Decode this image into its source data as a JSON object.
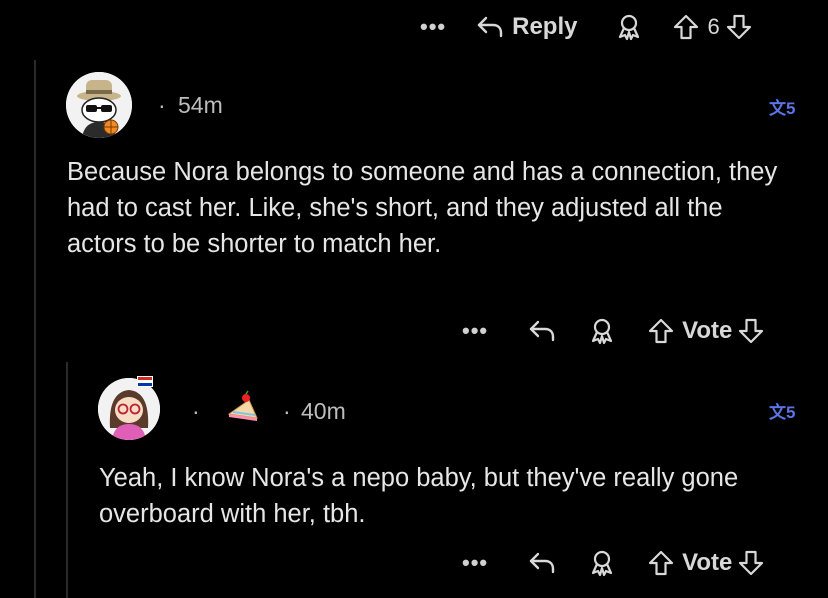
{
  "top_actions": {
    "reply_label": "Reply",
    "vote_count": "6"
  },
  "comment1": {
    "time": "54m",
    "separator": "·",
    "translate_label": "文5",
    "text": "Because Nora belongs to someone and has a connection, they had to cast her. Like, she's short, and they adjusted all the actors to be shorter to match her.",
    "vote_label": "Vote"
  },
  "comment2": {
    "time": "40m",
    "separator": "·",
    "translate_label": "文5",
    "text": "Yeah, I know Nora's a nepo baby, but they've really gone overboard with her, tbh.",
    "vote_label": "Vote"
  },
  "icons": {
    "more": "more-options-icon",
    "reply": "reply-arrow-icon",
    "award": "award-icon",
    "upvote": "upvote-icon",
    "downvote": "downvote-icon",
    "translate": "translate-icon"
  },
  "colors": {
    "background": "#000000",
    "accent": "#5b74e6",
    "text": "#e6e6e6"
  }
}
